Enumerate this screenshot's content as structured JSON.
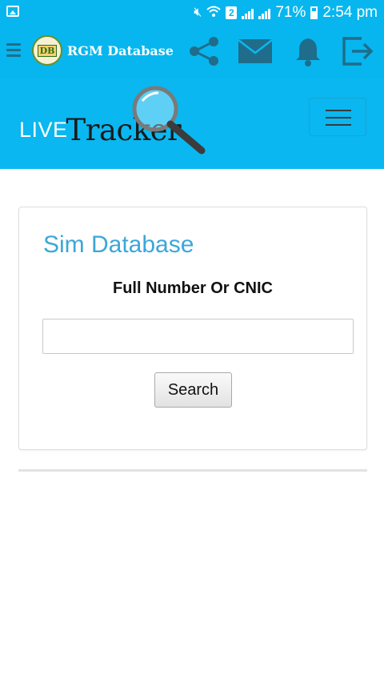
{
  "status_bar": {
    "battery": "71%",
    "time": "2:54 pm",
    "sim_slot": "2"
  },
  "app_bar": {
    "title": "RGM Database",
    "logo_text": "DB"
  },
  "hero": {
    "brand_live": "LIVE",
    "brand_tracker": "Tracker"
  },
  "card": {
    "title": "Sim Database",
    "field_label": "Full Number Or CNIC",
    "input_value": "",
    "input_placeholder": "",
    "button_label": "Search"
  },
  "colors": {
    "accent": "#07b6ee",
    "title_blue": "#3ba7d8"
  }
}
